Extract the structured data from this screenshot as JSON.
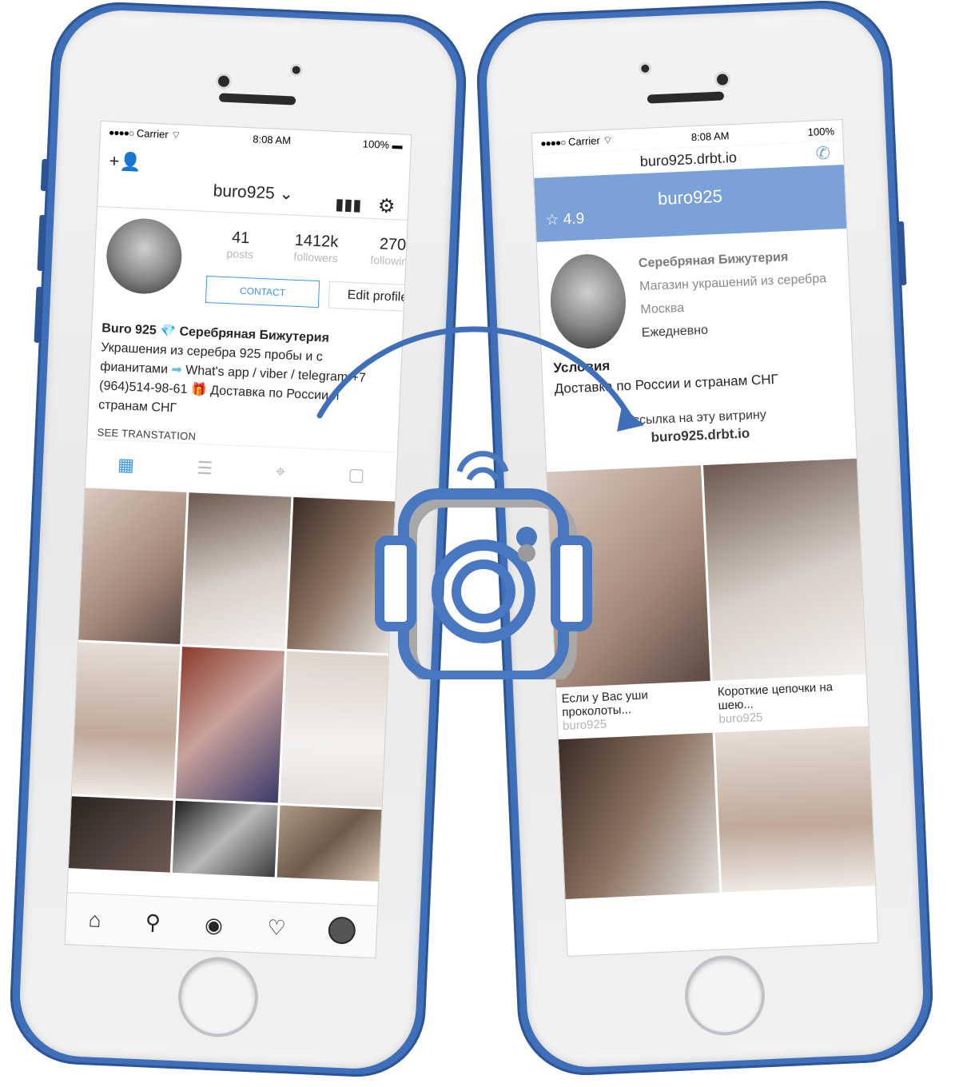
{
  "left_phone": {
    "status": {
      "carrier": "Carrier",
      "time": "8:08 AM",
      "battery": "100%"
    },
    "header": {
      "username": "buro925",
      "chevron": "chevron-down-icon"
    },
    "stats": {
      "posts": {
        "value": "41",
        "label": "posts"
      },
      "followers": {
        "value": "1412k",
        "label": "followers"
      },
      "following": {
        "value": "270",
        "label": "following"
      }
    },
    "buttons": {
      "contact": "CONTACT",
      "edit_profile": "Edit profile"
    },
    "bio": {
      "name": "Buro 925",
      "line1": "Серебряная Бижутерия",
      "line2": "Украшения из серебра 925 пробы и с фианитами",
      "line3": "What's app / viber / telegram +7 (964)514-98-61",
      "line4": "Доставка по России и странам СНГ",
      "see": "SEE TRANSTATION"
    },
    "icons": {
      "add_user": "add-user-icon",
      "stats": "bar-chart-icon",
      "settings": "gear-icon"
    }
  },
  "right_phone": {
    "status": {
      "carrier": "Carrier",
      "time": "8:08 AM",
      "battery": "100%"
    },
    "url": "buro925.drbt.io",
    "banner": {
      "name": "buro925",
      "rating": "4.9"
    },
    "info": {
      "title": "Серебряная Бижутерия",
      "subtitle": "Магазин украшений из серебра",
      "city": "Москва",
      "schedule": "Ежедневно"
    },
    "terms": {
      "heading": "Условия",
      "text": "Доставка по России и странам СНГ"
    },
    "link": {
      "caption": "ссылка на эту витрину",
      "url": "buro925.drbt.io"
    },
    "cards": [
      {
        "title": "Если у Вас уши проколоты...",
        "author": "buro925"
      },
      {
        "title": "Короткие цепочки на шею...",
        "author": "buro925"
      }
    ]
  },
  "colors": {
    "accent": "#3f6fb8",
    "banner": "#7aa1d8",
    "ig_blue": "#3897f0"
  }
}
